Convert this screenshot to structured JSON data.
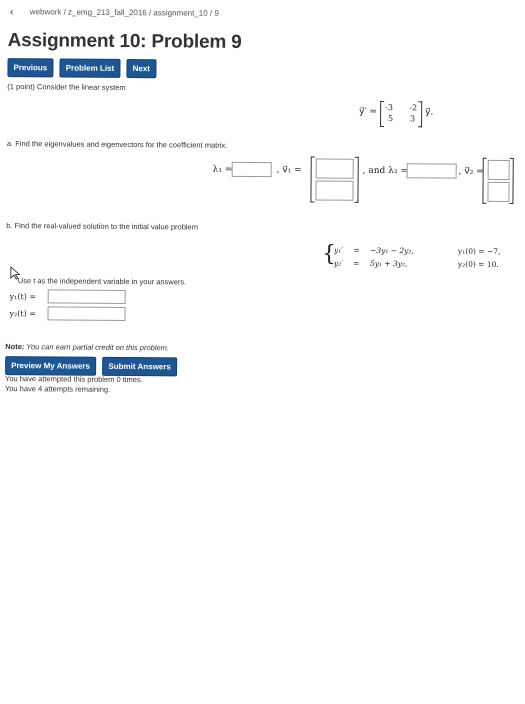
{
  "breadcrumb": {
    "back_icon": "chevron-left-icon",
    "path": "webwork / z_emg_213_fall_2016 / assignment_10 / 9"
  },
  "page_title": "Assignment 10: Problem 9",
  "nav": {
    "previous": "Previous",
    "problem_list": "Problem List",
    "next": "Next"
  },
  "problem": {
    "intro": "(1 point) Consider the linear system",
    "system_lhs": "y⃗′ =",
    "matrix": [
      "-3",
      "-2",
      "5",
      "3"
    ],
    "system_rhs": "y⃗.",
    "part_a": "a. Find the eigenvalues and eigenvectors for the coefficient matrix.",
    "lambda1": "λ₁ =",
    "v1": ", v⃗₁ =",
    "and": ", and λ₂ =",
    "v2": ", v⃗₂ =",
    "part_b": "b. Find the real-valued solution to the initial value problem",
    "ivp": [
      {
        "lhs": "y₁′",
        "eq": "=",
        "rhs": "−3y₁ − 2y₂,",
        "ic": "y₁(0) = −7,"
      },
      {
        "lhs": "y₂′",
        "eq": "=",
        "rhs": "5y₁ + 3y₂,",
        "ic": "y₂(0) = 10."
      }
    ],
    "hint": "Use t as the independent variable in your answers.",
    "y1_label": "y₁(t) =",
    "y2_label": "y₂(t) ="
  },
  "note": {
    "bold": "Note:",
    "text": " You can earn partial credit on this problem."
  },
  "actions": {
    "preview": "Preview My Answers",
    "submit": "Submit Answers"
  },
  "status": {
    "attempted": "You have attempted this problem 0 times.",
    "remaining": "You have 4 attempts remaining."
  }
}
